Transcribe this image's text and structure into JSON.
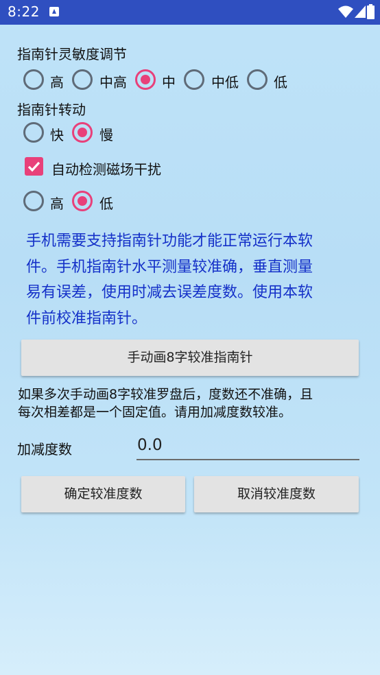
{
  "status_bar": {
    "time": "8:22"
  },
  "sensitivity": {
    "label": "指南针灵敏度调节",
    "options": [
      "高",
      "中高",
      "中",
      "中低",
      "低"
    ],
    "selected": "中"
  },
  "rotation": {
    "label": "指南针转动",
    "options": [
      "快",
      "慢"
    ],
    "selected": "慢"
  },
  "auto_detect": {
    "label": "自动检测磁场干扰",
    "checked": true
  },
  "interference": {
    "options": [
      "高",
      "低"
    ],
    "selected": "低"
  },
  "notice": {
    "line1": "手机需要支持指南针功能才能正常运行本软",
    "line2": "件。手机指南针水平测量较准确，垂直测量",
    "line3": "易有误差，使用时减去误差度数。使用本软",
    "line4": "件前校准指南针。"
  },
  "calibrate_button": "手动画8字较准指南针",
  "hint": {
    "line1": "如果多次手动画8字较准罗盘后，度数还不准确，且",
    "line2": "每次相差都是一个固定值。请用加减度数较准。"
  },
  "offset": {
    "label": "加减度数",
    "value": "0.0"
  },
  "confirm_button": "确定较准度数",
  "cancel_button": "取消较准度数",
  "colors": {
    "status_bar": "#2f4fc0",
    "accent": "#e8407a",
    "notice_text": "#1430c8"
  }
}
